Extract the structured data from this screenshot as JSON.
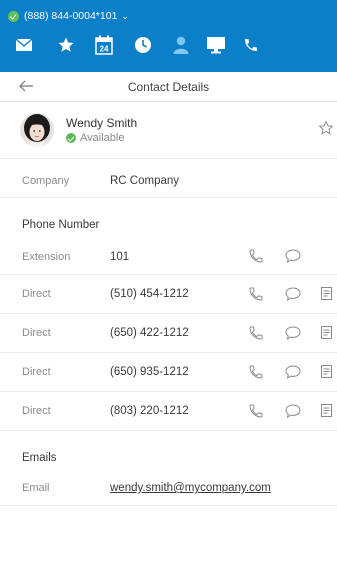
{
  "topbar": {
    "phone_line": "(888) 844-0004*101",
    "caret": "⌄",
    "nav_icons": [
      "envelope-icon",
      "star-icon",
      "calendar-icon",
      "clock-icon",
      "person-icon",
      "monitor-icon",
      "phone-icon"
    ],
    "calendar_day": "24"
  },
  "header": {
    "title": "Contact Details"
  },
  "contact": {
    "name": "Wendy Smith",
    "presence": "Available"
  },
  "company": {
    "label": "Company",
    "value": "RC Company"
  },
  "phones": {
    "section_title": "Phone Number",
    "items": [
      {
        "label": "Extension",
        "value": "101"
      },
      {
        "label": "Direct",
        "value": "(510) 454-1212"
      },
      {
        "label": "Direct",
        "value": "(650) 422-1212"
      },
      {
        "label": "Direct",
        "value": "(650) 935-1212"
      },
      {
        "label": "Direct",
        "value": "(803) 220-1212"
      }
    ]
  },
  "emails": {
    "section_title": "Emails",
    "items": [
      {
        "label": "Email",
        "value": "wendy.smith@mycompany.com"
      }
    ]
  },
  "colors": {
    "brand": "#0b7fc7",
    "available": "#5cb85c",
    "link": "#2272c4"
  }
}
